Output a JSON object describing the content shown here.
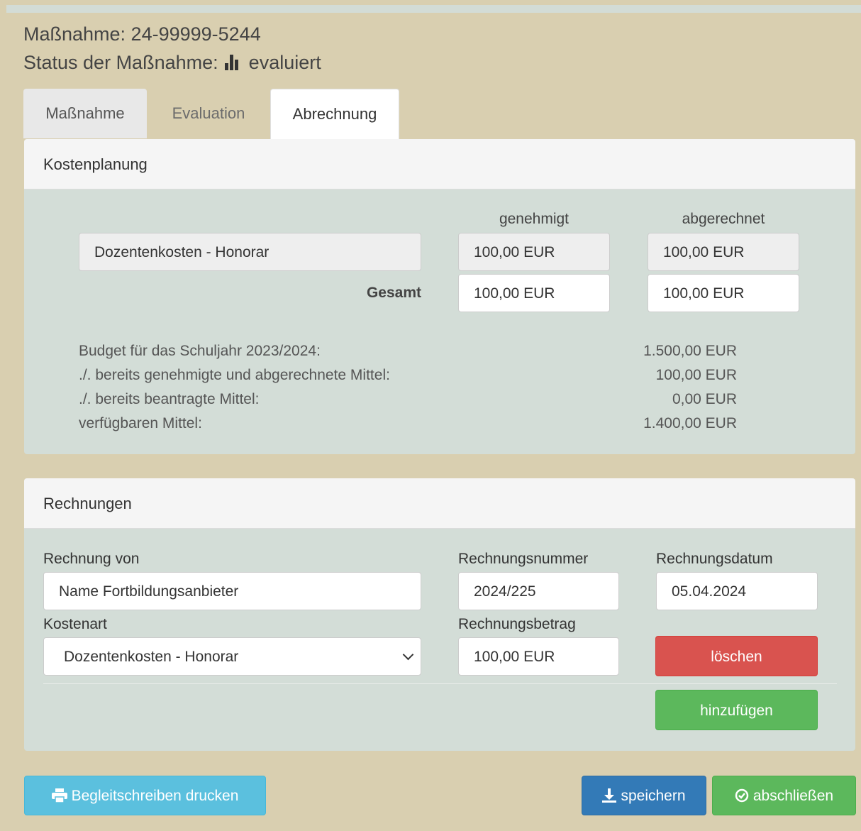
{
  "header": {
    "measure_label": "Maßnahme: 24-99999-5244",
    "status_label": "Status der Maßnahme:",
    "status_value": "evaluiert",
    "status_icon": "bar-chart-icon"
  },
  "tabs": [
    {
      "label": "Maßnahme"
    },
    {
      "label": "Evaluation"
    },
    {
      "label": "Abrechnung",
      "active": true
    }
  ],
  "kostenplanung": {
    "title": "Kostenplanung",
    "col_approved": "genehmigt",
    "col_settled": "abgerechnet",
    "item_name": "Dozentenkosten - Honorar",
    "item_approved": "100,00 EUR",
    "item_settled": "100,00 EUR",
    "total_label": "Gesamt",
    "total_approved": "100,00 EUR",
    "total_settled": "100,00 EUR",
    "budget": [
      {
        "label": "Budget für das Schuljahr 2023/2024:",
        "value": "1.500,00 EUR"
      },
      {
        "label": "./. bereits genehmigte und abgerechnete Mittel:",
        "value": "100,00 EUR"
      },
      {
        "label": "./. bereits beantragte Mittel:",
        "value": "0,00 EUR"
      },
      {
        "label": "verfügbaren Mittel:",
        "value": "1.400,00 EUR"
      }
    ]
  },
  "rechnungen": {
    "title": "Rechnungen",
    "from_label": "Rechnung von",
    "from_value": "Name Fortbildungsanbieter",
    "number_label": "Rechnungsnummer",
    "number_value": "2024/225",
    "date_label": "Rechnungsdatum",
    "date_value": "05.04.2024",
    "cost_type_label": "Kostenart",
    "cost_type_value": "Dozentenkosten - Honorar",
    "amount_label": "Rechnungsbetrag",
    "amount_value": "100,00 EUR",
    "delete_label": "löschen",
    "add_label": "hinzufügen",
    "colors": {
      "delete": "#d9534f",
      "add": "#5cb85c"
    }
  },
  "footer": {
    "print_label": "Begleitschreiben drucken",
    "print_icon": "print-icon",
    "save_label": "speichern",
    "save_icon": "download-icon",
    "close_label": "abschließen",
    "close_icon": "check-circle-icon",
    "colors": {
      "print": "#5bc0de",
      "save": "#337ab7",
      "close": "#5cb85c"
    }
  }
}
